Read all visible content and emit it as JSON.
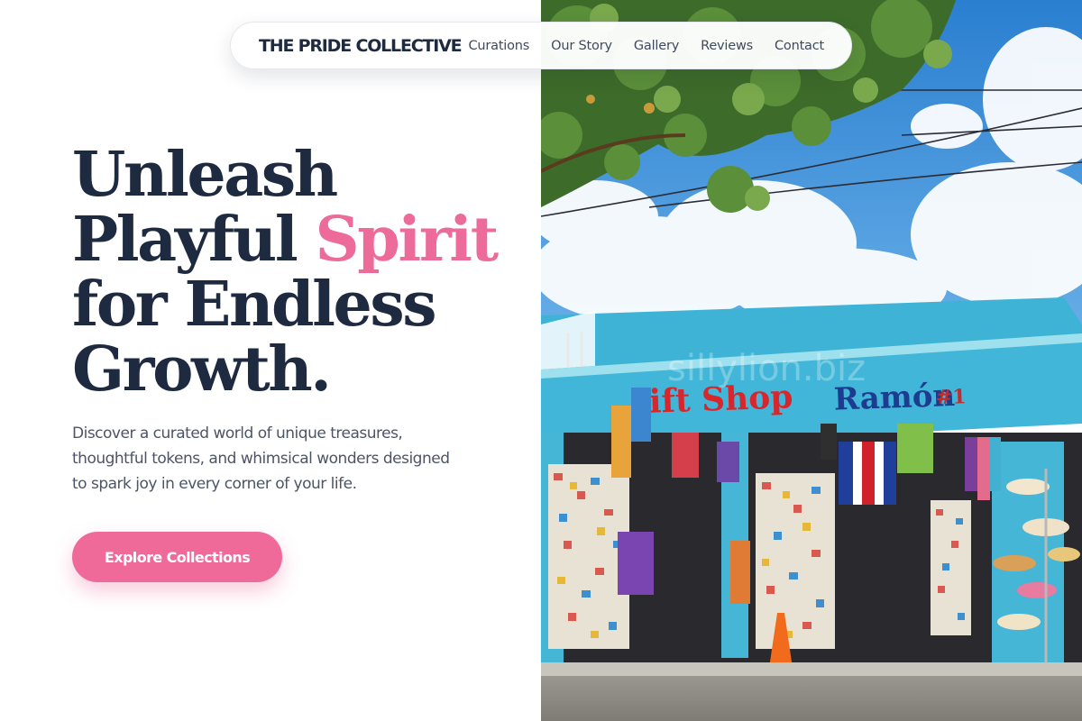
{
  "nav": {
    "brand": "THE PRIDE COLLECTIVE",
    "links": [
      "Curations",
      "Our Story",
      "Gallery",
      "Reviews",
      "Contact"
    ]
  },
  "hero": {
    "headline_line1": "Unleash",
    "headline_line2_a": "Playful",
    "headline_line2_accent": "Spirit",
    "headline_line3": "for Endless",
    "headline_line4": "Growth.",
    "subtext": "Discover a curated world of unique treasures, thoughtful tokens, and whimsical wonders designed to spark joy in every corner of your life.",
    "cta_label": "Explore Collections"
  },
  "image": {
    "shop_sign_left": "ift Shop",
    "shop_sign_right": "Ramón",
    "shop_sign_number": "#1",
    "watermark": "sillylion.biz"
  },
  "colors": {
    "navy": "#1e2a40",
    "accent_pink": "#ec6b99",
    "button_pink": "#ef6a98",
    "shop_teal": "#3fb3d6",
    "sky_blue": "#2f8fd8"
  }
}
